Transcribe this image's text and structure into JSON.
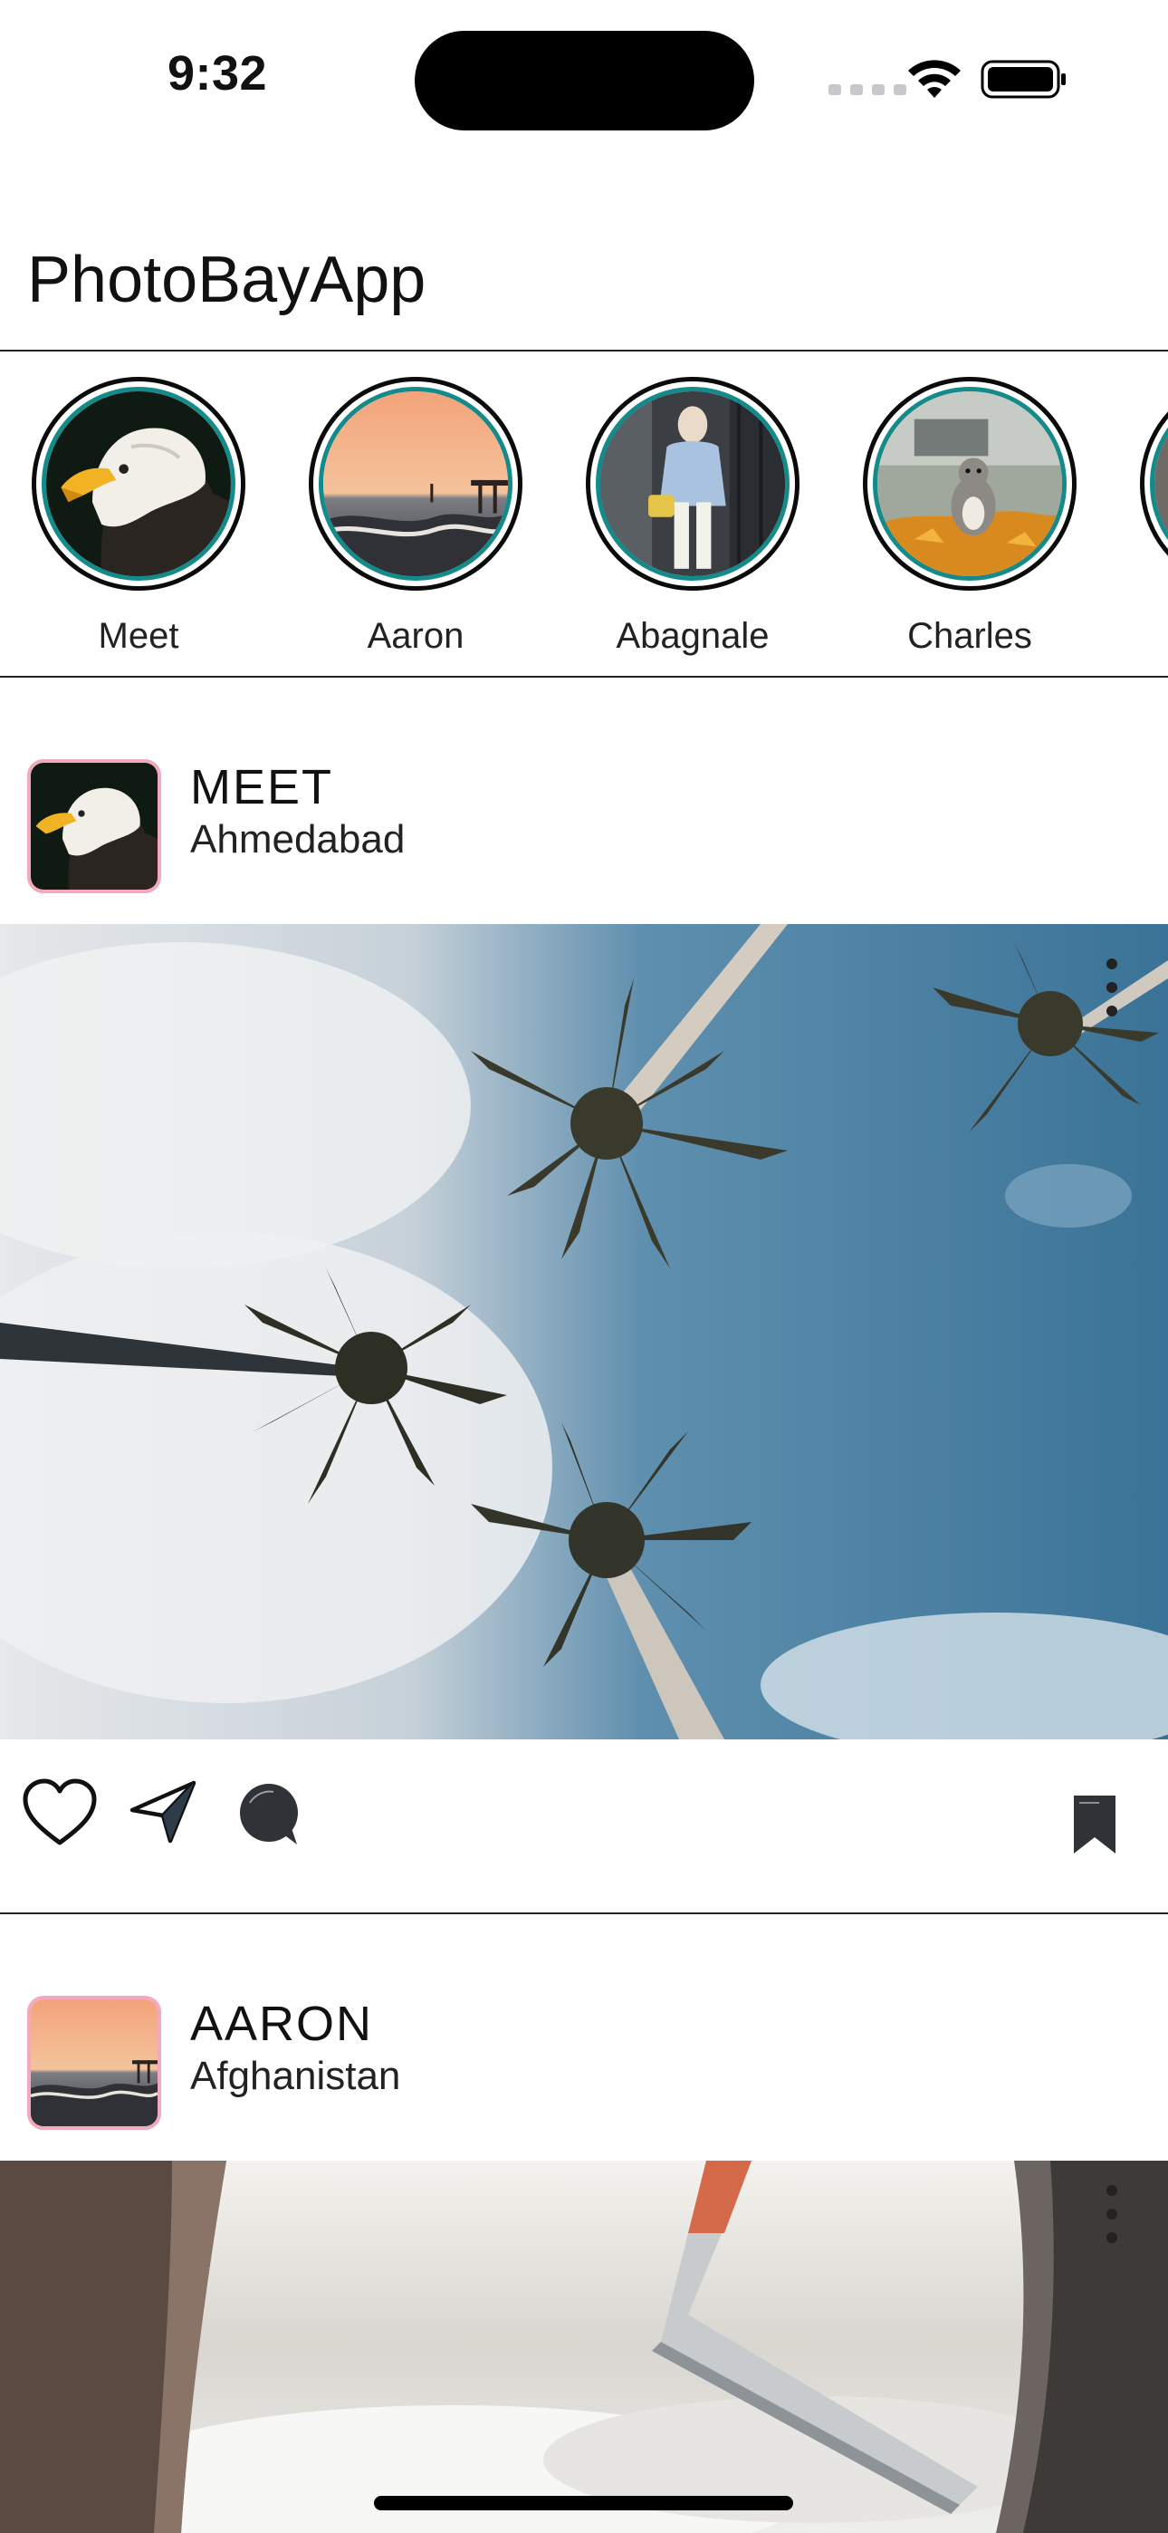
{
  "status_bar": {
    "time": "9:32"
  },
  "header": {
    "title": "PhotoBayApp"
  },
  "stories": [
    {
      "name": "Meet",
      "image": "eagle"
    },
    {
      "name": "Aaron",
      "image": "sunset-pier"
    },
    {
      "name": "Abagnale",
      "image": "fashion-woman"
    },
    {
      "name": "Charles",
      "image": "squirrel"
    },
    {
      "name": "",
      "image": "partial"
    }
  ],
  "posts": [
    {
      "username": "MEET",
      "location": "Ahmedabad",
      "avatar": "eagle",
      "image": "palm-trees-sky"
    },
    {
      "username": "AARON",
      "location": "Afghanistan",
      "avatar": "sunset-pier",
      "image": "airplane-wing-clouds"
    }
  ],
  "icons": {
    "like": "heart-icon",
    "share": "paper-plane-icon",
    "comment": "comment-bubble-icon",
    "save": "bookmark-icon",
    "more": "more-vertical-icon"
  },
  "colors": {
    "story_ring_outer": "#0b0b0b",
    "story_ring_inner": "#158a8a",
    "post_avatar_border": "#f4a8bd",
    "text": "#111111"
  }
}
